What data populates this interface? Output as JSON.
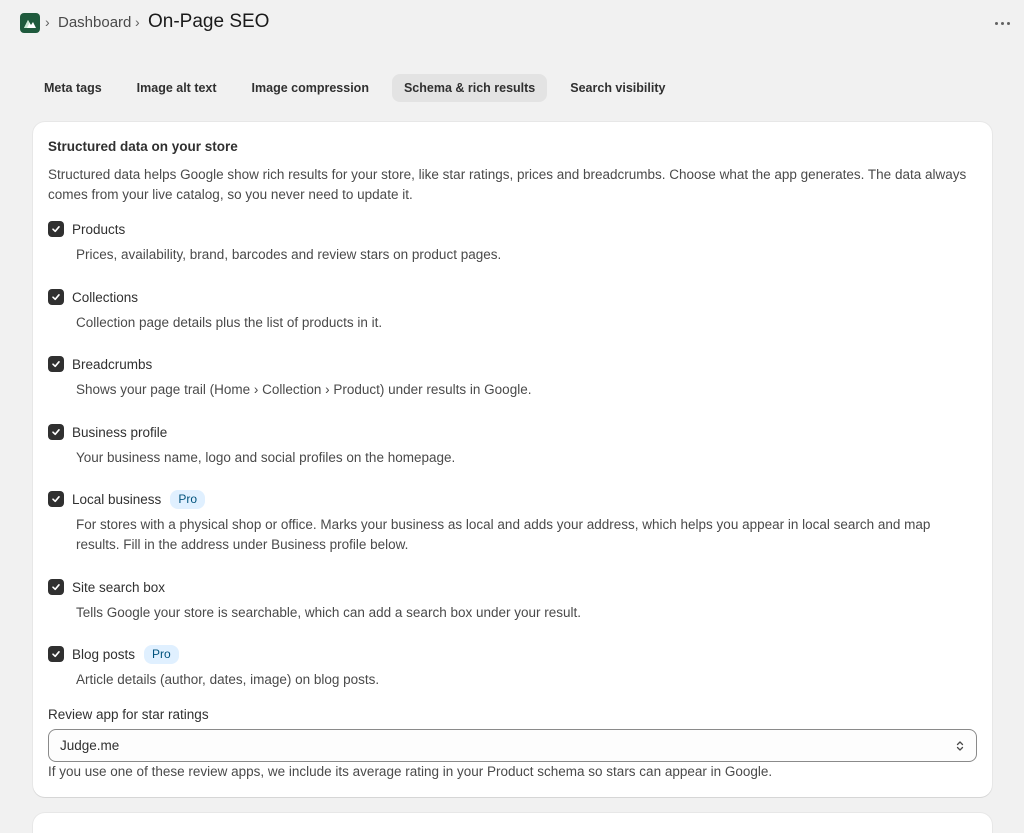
{
  "header": {
    "breadcrumb": "Dashboard",
    "title": "On-Page SEO",
    "app_icon": "mountain-logo-icon",
    "more_icon": "more-horizontal-icon"
  },
  "tabs": [
    {
      "label": "Meta tags",
      "active": false
    },
    {
      "label": "Image alt text",
      "active": false
    },
    {
      "label": "Image compression",
      "active": false
    },
    {
      "label": "Schema & rich results",
      "active": true
    },
    {
      "label": "Search visibility",
      "active": false
    }
  ],
  "card": {
    "title": "Structured data on your store",
    "description": "Structured data helps Google show rich results for your store, like star ratings, prices and breadcrumbs. Choose what the app generates. The data always comes from your live catalog, so you never need to update it.",
    "options": [
      {
        "label": "Products",
        "checked": true,
        "badge": "",
        "help": "Prices, availability, brand, barcodes and review stars on product pages."
      },
      {
        "label": "Collections",
        "checked": true,
        "badge": "",
        "help": "Collection page details plus the list of products in it."
      },
      {
        "label": "Breadcrumbs",
        "checked": true,
        "badge": "",
        "help": "Shows your page trail (Home › Collection › Product) under results in Google."
      },
      {
        "label": "Business profile",
        "checked": true,
        "badge": "",
        "help": "Your business name, logo and social profiles on the homepage."
      },
      {
        "label": "Local business",
        "checked": true,
        "badge": "Pro",
        "help": "For stores with a physical shop or office. Marks your business as local and adds your address, which helps you appear in local search and map results. Fill in the address under Business profile below."
      },
      {
        "label": "Site search box",
        "checked": true,
        "badge": "",
        "help": "Tells Google your store is searchable, which can add a search box under your result."
      },
      {
        "label": "Blog posts",
        "checked": true,
        "badge": "Pro",
        "help": "Article details (author, dates, image) on blog posts."
      }
    ],
    "review_select": {
      "label": "Review app for star ratings",
      "value": "Judge.me",
      "help": "If you use one of these review apps, we include its average rating in your Product schema so stars can appear in Google."
    }
  },
  "colors": {
    "background": "#f1f1f1",
    "checkbox": "#303030",
    "pro_badge_bg": "#e0f0ff",
    "pro_badge_text": "#00527c",
    "app_icon_bg": "#1f5a3d"
  }
}
